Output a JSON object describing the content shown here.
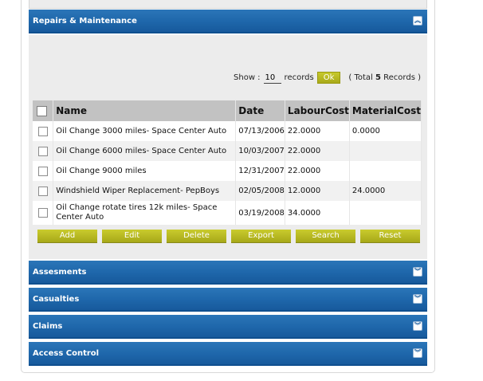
{
  "panels": {
    "repairs": {
      "title": "Repairs & Maintenance",
      "toggle_icon": "collapse-up-icon"
    },
    "collapsed": [
      {
        "title": "Assesments"
      },
      {
        "title": "Casualties"
      },
      {
        "title": "Claims"
      },
      {
        "title": "Access Control"
      }
    ]
  },
  "paging": {
    "show_label": "Show :",
    "records_value": "10",
    "records_label": "records",
    "ok_label": "Ok",
    "total_prefix": "( Total",
    "total_count": "5",
    "total_suffix": "Records )"
  },
  "table": {
    "columns": [
      "Name",
      "Date",
      "LabourCost",
      "MaterialCost"
    ],
    "rows": [
      {
        "name": "Oil Change 3000 miles- Space Center Auto",
        "date": "07/13/2006",
        "labour": "22.0000",
        "material": "0.0000"
      },
      {
        "name": "Oil Change 6000 miles- Space Center Auto",
        "date": "10/03/2007",
        "labour": "22.0000",
        "material": ""
      },
      {
        "name": "Oil Change 9000 miles",
        "date": "12/31/2007",
        "labour": "22.0000",
        "material": ""
      },
      {
        "name": "Windshield Wiper Replacement- PepBoys",
        "date": "02/05/2008",
        "labour": "12.0000",
        "material": "24.0000"
      },
      {
        "name": "Oil Change rotate tires 12k miles- Space Center Auto",
        "date": "03/19/2008",
        "labour": "34.0000",
        "material": ""
      }
    ]
  },
  "actions": [
    "Add",
    "Edit",
    "Delete",
    "Export",
    "Search",
    "Reset"
  ],
  "colors": {
    "header_blue": "#1e66aa",
    "button_olive": "#b7b922",
    "body_gray": "#ececec"
  }
}
